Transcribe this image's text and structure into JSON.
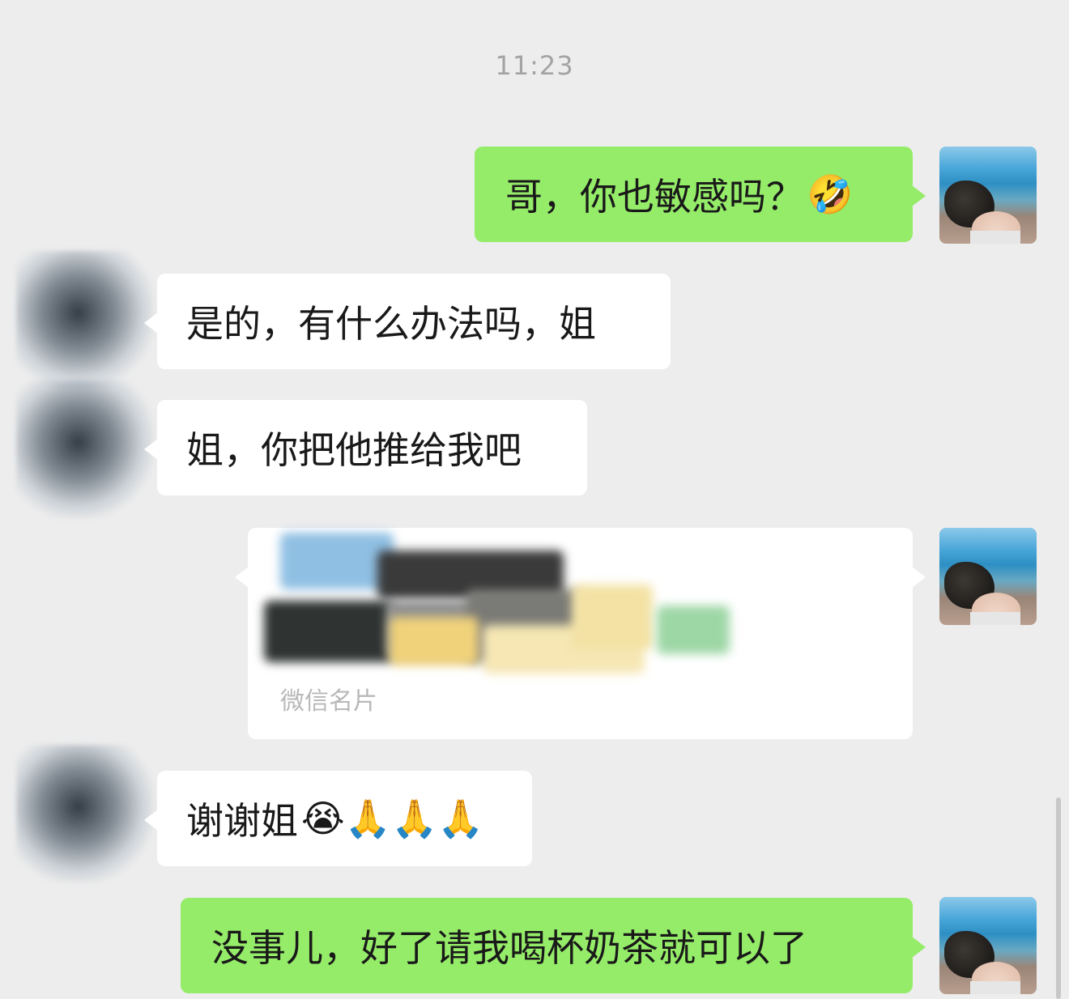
{
  "chat": {
    "timestamp": "11:23",
    "messages": [
      {
        "sender": "self",
        "text": "哥，你也敏感吗？",
        "emoji": "🤣"
      },
      {
        "sender": "other",
        "text": "是的，有什么办法吗，姐"
      },
      {
        "sender": "other",
        "text": "姐，你把他推给我吧"
      },
      {
        "sender": "self",
        "type": "contact-card",
        "label": "微信名片"
      },
      {
        "sender": "other",
        "text": "谢谢姐",
        "emoji": "😭🙏🙏🙏"
      },
      {
        "sender": "self",
        "text": "没事儿，好了请我喝杯奶茶就可以了"
      }
    ]
  },
  "colors": {
    "background": "#ededed",
    "self_bubble": "#95ec69",
    "other_bubble": "#ffffff"
  }
}
